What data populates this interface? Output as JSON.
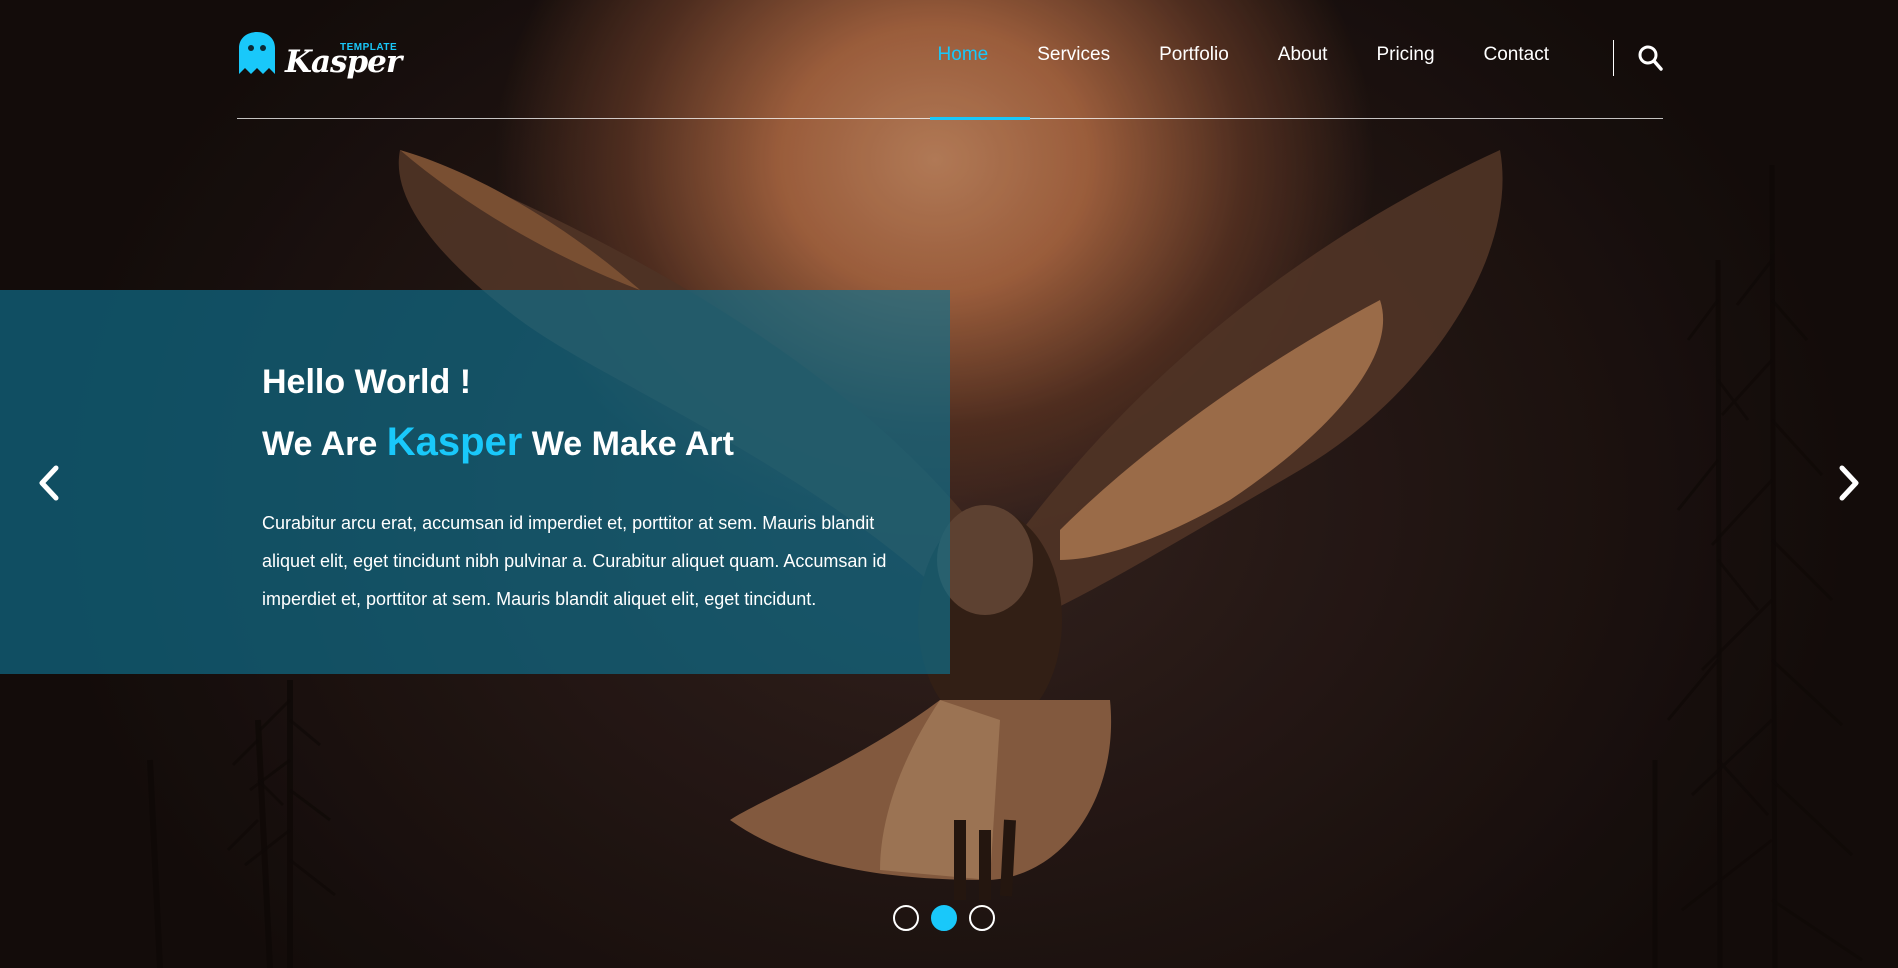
{
  "logo": {
    "tag": "TEMPLATE",
    "name": "Kasper"
  },
  "nav": [
    {
      "label": "Home",
      "active": true
    },
    {
      "label": "Services"
    },
    {
      "label": "Portfolio"
    },
    {
      "label": "About"
    },
    {
      "label": "Pricing"
    },
    {
      "label": "Contact"
    }
  ],
  "slide": {
    "line1": "Hello World !",
    "line2_before": "We Are ",
    "line2_brand": "Kasper",
    "line2_after": " We Make Art",
    "description": "Curabitur arcu erat, accumsan id imperdiet et, porttitor at sem. Mauris blandit aliquet elit, eget tincidunt nibh pulvinar a. Curabitur aliquet quam. Accumsan id imperdiet et, porttitor at sem. Mauris blandit aliquet elit, eget tincidunt."
  },
  "slider": {
    "active_index": 2,
    "total": 3
  },
  "colors": {
    "accent": "#19c8fa",
    "panel": "#0f6e8c"
  },
  "icons": {
    "search": "search-icon",
    "prev": "chevron-left-icon",
    "next": "chevron-right-icon",
    "logo": "ghost-icon"
  }
}
